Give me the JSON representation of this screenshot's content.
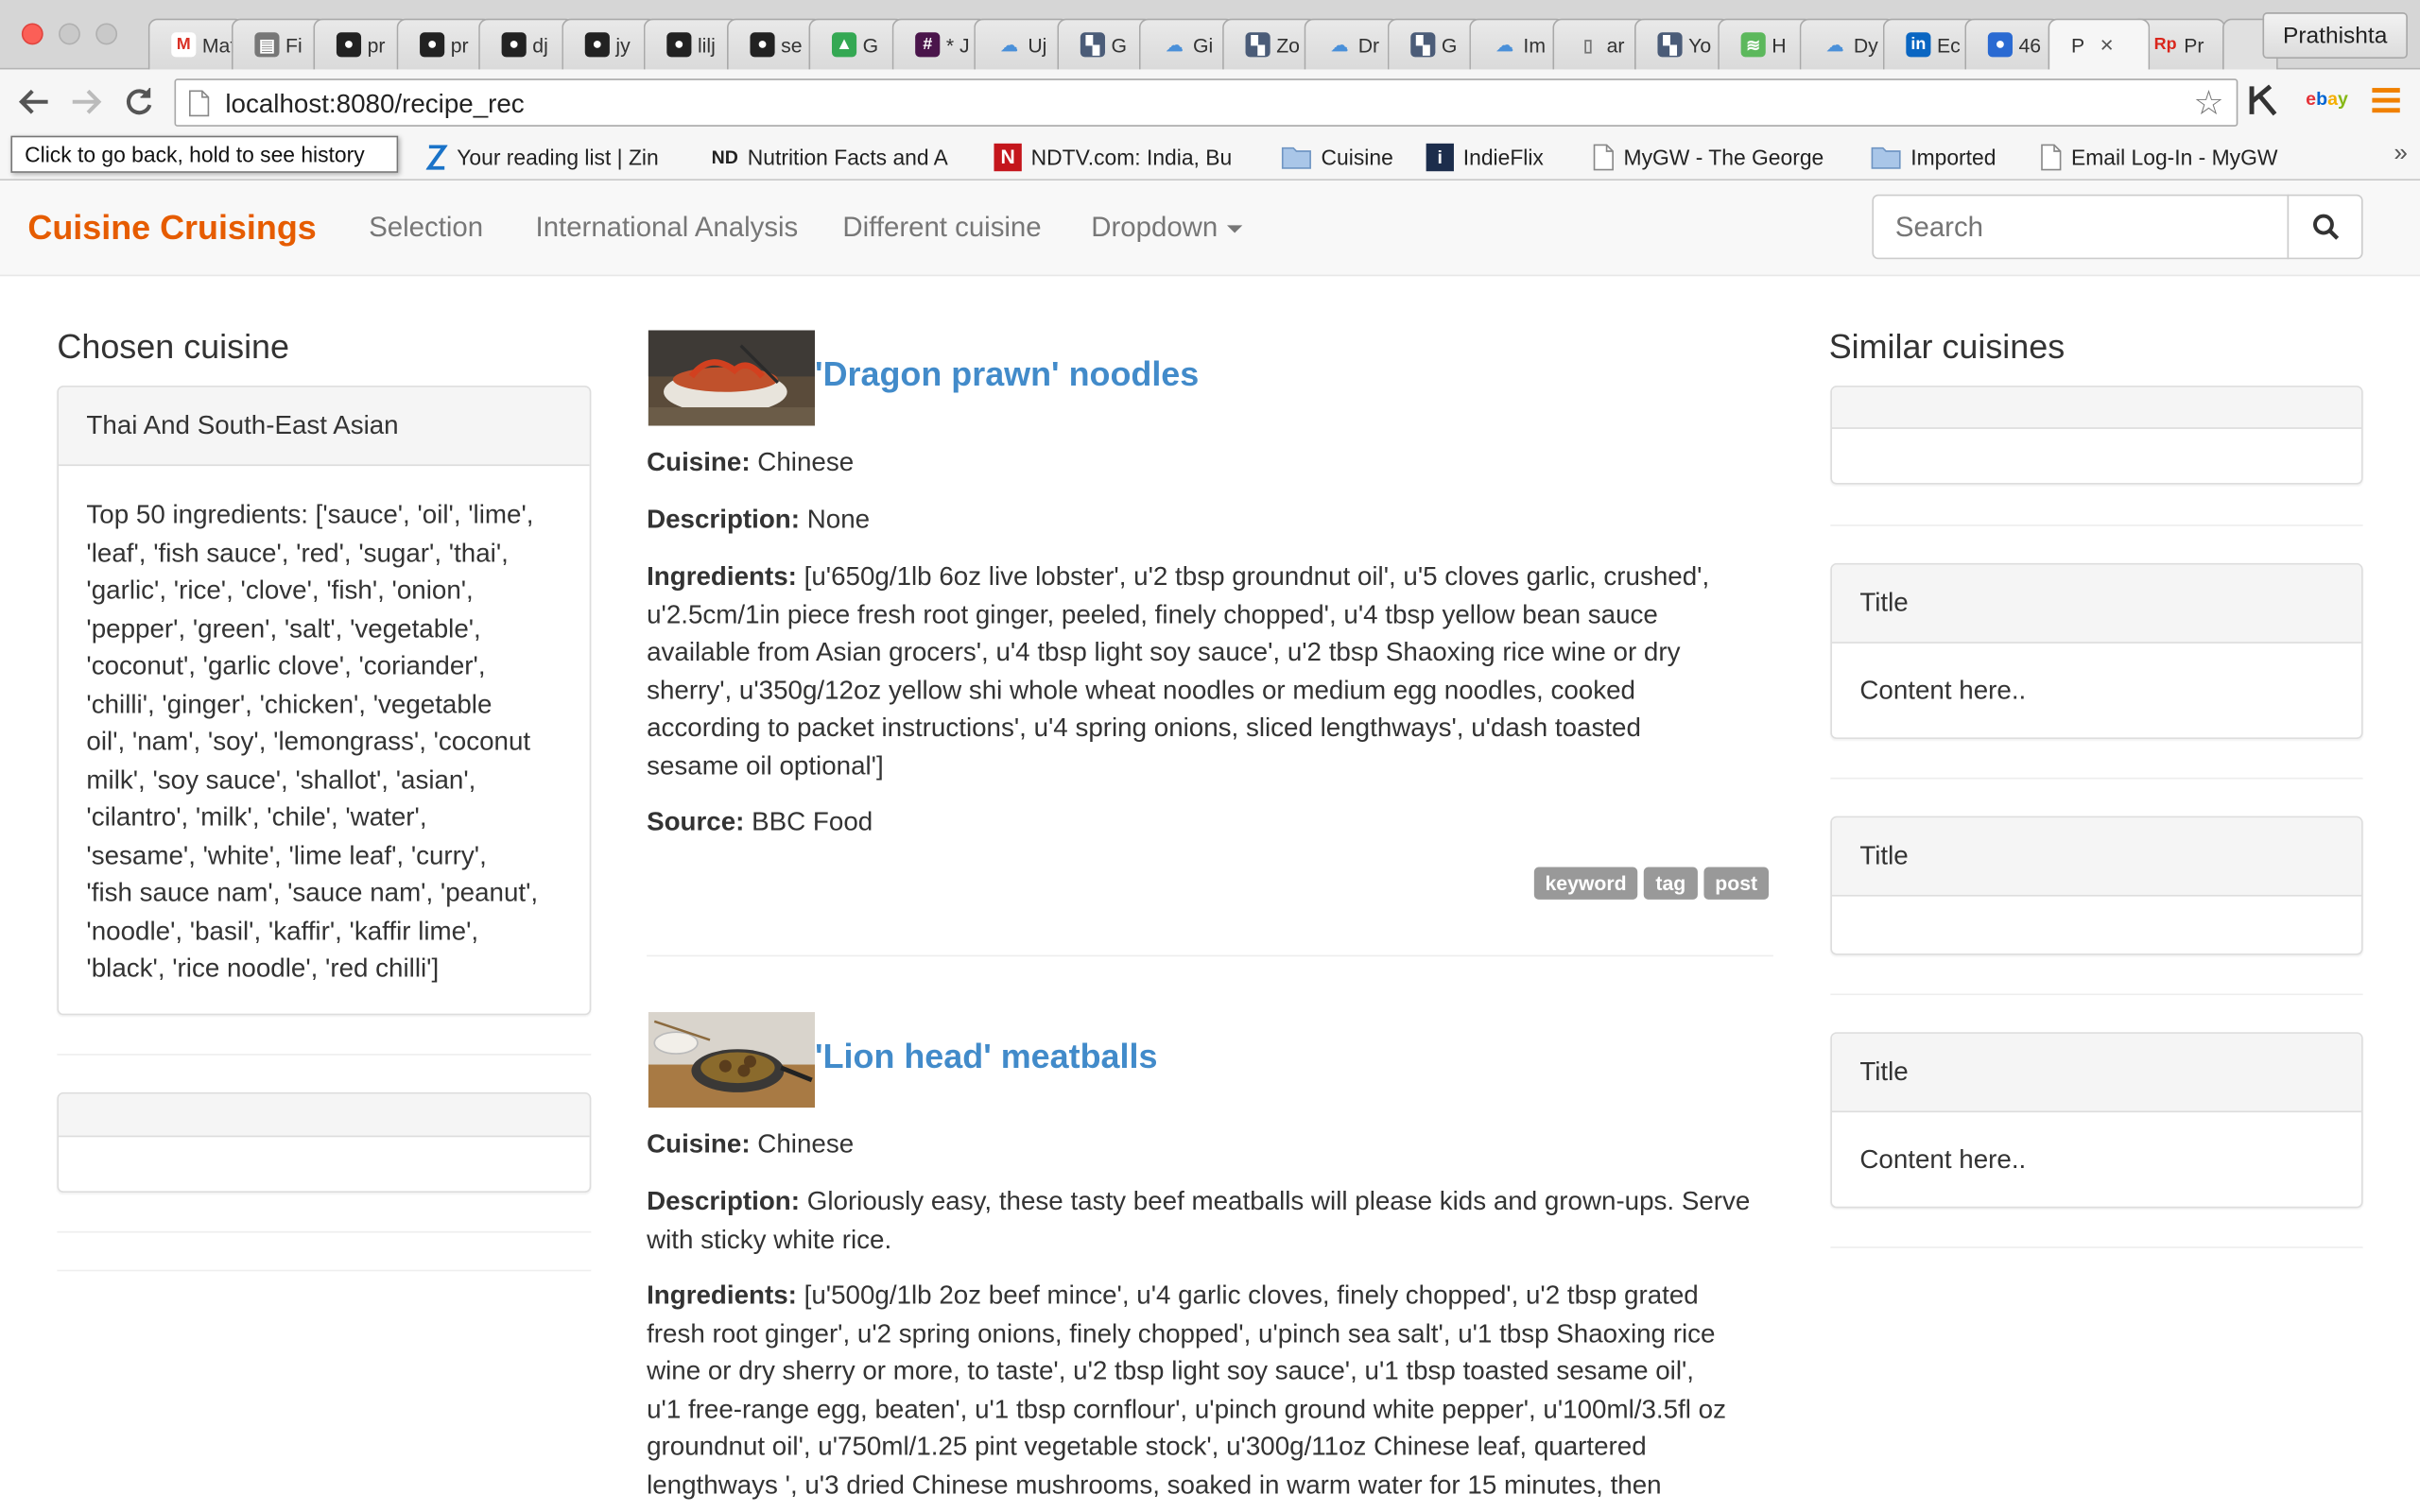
{
  "browser": {
    "tabs": [
      {
        "label": "Mat",
        "icon": "gmail-icon"
      },
      {
        "label": "Fi",
        "icon": "file-icon"
      },
      {
        "label": "pr",
        "icon": "github-icon"
      },
      {
        "label": "pr",
        "icon": "github-icon"
      },
      {
        "label": "dj",
        "icon": "github-icon"
      },
      {
        "label": "jy",
        "icon": "github-icon"
      },
      {
        "label": "lilj",
        "icon": "github-icon"
      },
      {
        "label": "se",
        "icon": "github-icon"
      },
      {
        "label": "G",
        "icon": "drive-icon"
      },
      {
        "label": "* J",
        "icon": "slack-icon"
      },
      {
        "label": "Uj",
        "icon": "cloud-icon"
      },
      {
        "label": "G",
        "icon": "wiki-icon"
      },
      {
        "label": "Gi",
        "icon": "cloud-icon"
      },
      {
        "label": "Zo",
        "icon": "wiki-icon"
      },
      {
        "label": "Dr",
        "icon": "cloud-icon"
      },
      {
        "label": "G",
        "icon": "wiki-icon"
      },
      {
        "label": "Im",
        "icon": "cloud-icon"
      },
      {
        "label": "ar",
        "icon": "doc-icon"
      },
      {
        "label": "Yo",
        "icon": "wiki-icon"
      },
      {
        "label": "H",
        "icon": "green-icon"
      },
      {
        "label": "Dy",
        "icon": "cloud-icon"
      },
      {
        "label": "Ec",
        "icon": "linkedin-icon"
      },
      {
        "label": "46",
        "icon": "globe-icon"
      },
      {
        "label": "P",
        "icon": "none",
        "active": true
      },
      {
        "label": "Pr",
        "icon": "rp-icon"
      }
    ],
    "profile_name": "Prathishta",
    "url_host": "localhost",
    "url_rest": ":8080/recipe_rec",
    "back_tooltip": "Click to go back, hold to see history",
    "bookmarks": [
      {
        "label": "Your reading list | Zin",
        "icon": "zinio-icon"
      },
      {
        "label": "Nutrition Facts and A",
        "icon": "nd-icon"
      },
      {
        "label": "NDTV.com: India, Bu",
        "icon": "ndtv-icon"
      },
      {
        "label": "Cuisine",
        "icon": "folder-icon"
      },
      {
        "label": "IndieFlix",
        "icon": "indieflix-icon"
      },
      {
        "label": "MyGW - The George",
        "icon": "doc-icon"
      },
      {
        "label": "Imported",
        "icon": "folder-icon"
      },
      {
        "label": "Email Log-In - MyGW",
        "icon": "doc-icon"
      }
    ],
    "bookmarks_overflow": "»"
  },
  "navbar": {
    "brand": "Cuisine Cruisings",
    "links": [
      "Selection",
      "International Analysis",
      "Different cuisine",
      "Dropdown"
    ],
    "search_placeholder": "Search"
  },
  "left": {
    "title": "Chosen cuisine",
    "cuisine_name": "Thai And South-East Asian",
    "ingredients_lines": [
      "Top 50 ingredients: ['sauce', 'oil', 'lime',",
      "'leaf', 'fish sauce', 'red', 'sugar', 'thai',",
      "'garlic', 'rice', 'clove', 'fish', 'onion',",
      "'pepper', 'green', 'salt', 'vegetable',",
      "'coconut', 'garlic clove', 'coriander',",
      "'chilli', 'ginger', 'chicken', 'vegetable",
      "oil', 'nam', 'soy', 'lemongrass', 'coconut",
      "milk', 'soy sauce', 'shallot', 'asian',",
      "'cilantro', 'milk', 'chile', 'water',",
      "'sesame', 'white', 'lime leaf', 'curry',",
      "'fish sauce nam', 'sauce nam', 'peanut',",
      "'noodle', 'basil', 'kaffir', 'kaffir lime',",
      "'black', 'rice noodle', 'red chilli']"
    ]
  },
  "recipes": [
    {
      "title": "'Dragon prawn' noodles",
      "cuisine_label": "Cuisine:",
      "cuisine": "Chinese",
      "description_label": "Description:",
      "description": "None",
      "ingredients_label": "Ingredients:",
      "ingredients_lines": [
        "[u'650g/1lb 6oz live lobster', u'2 tbsp groundnut oil', u'5 cloves garlic, crushed',",
        "u'2.5cm/1in piece fresh root ginger, peeled, finely chopped', u'4 tbsp yellow bean sauce",
        "available from Asian grocers', u'4 tbsp light soy sauce', u'2 tbsp Shaoxing rice wine or dry",
        "sherry', u'350g/12oz yellow shi whole wheat noodles or medium egg noodles, cooked",
        "according to packet instructions', u'4 spring onions, sliced lengthways', u'dash toasted",
        "sesame oil optional']"
      ],
      "source_label": "Source:",
      "source": "BBC Food",
      "tags": [
        "keyword",
        "tag",
        "post"
      ]
    },
    {
      "title": "'Lion head' meatballs",
      "cuisine_label": "Cuisine:",
      "cuisine": "Chinese",
      "description_label": "Description:",
      "description_lines": [
        "Gloriously easy, these tasty beef meatballs will please kids and grown-ups. Serve",
        "with sticky white rice."
      ],
      "ingredients_label": "Ingredients:",
      "ingredients_lines": [
        "[u'500g/1lb 2oz beef mince', u'4 garlic cloves, finely chopped', u'2 tbsp grated",
        "fresh root ginger', u'2 spring onions, finely chopped', u'pinch sea salt', u'1 tbsp Shaoxing rice",
        "wine or dry sherry or more, to taste', u'2 tbsp light soy sauce', u'1 tbsp toasted sesame oil',",
        "u'1 free-range egg, beaten', u'1 tbsp cornflour', u'pinch ground white pepper', u'100ml/3.5fl oz",
        "groundnut oil', u'750ml/1.25 pint vegetable stock', u'300g/11oz Chinese leaf, quartered",
        "lengthways ', u'3 dried Chinese mushrooms, soaked in warm water for 15 minutes, then"
      ]
    }
  ],
  "right": {
    "title": "Similar cuisines",
    "panels": [
      {
        "heading": "",
        "body": ""
      },
      {
        "heading": "Title",
        "body": "Content here.."
      },
      {
        "heading": "Title",
        "body": ""
      },
      {
        "heading": "Title",
        "body": "Content here.."
      }
    ]
  },
  "colors": {
    "brand": "#e65c00",
    "link": "#428bca",
    "tag_bg": "#999999"
  }
}
